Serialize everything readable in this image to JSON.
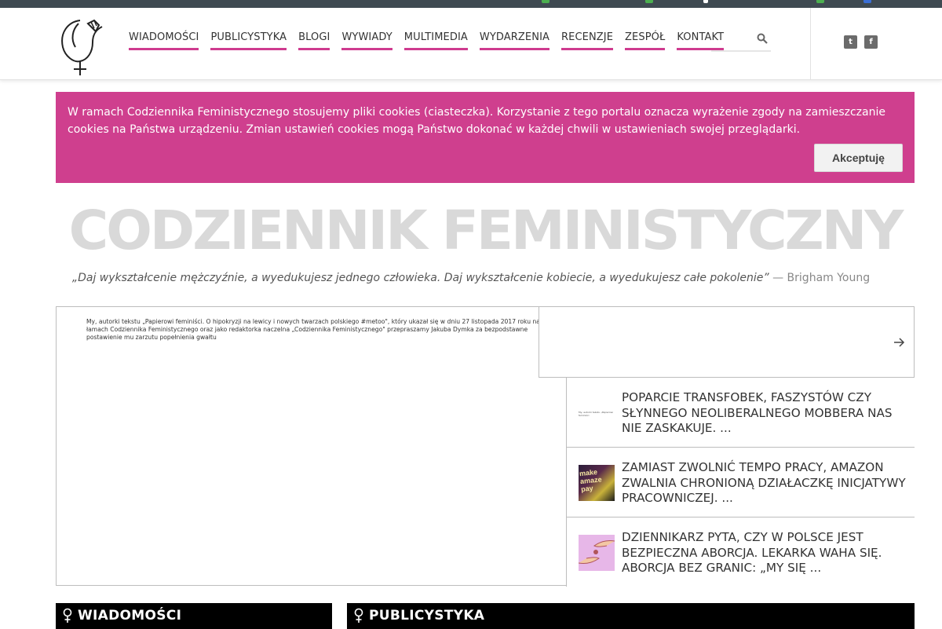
{
  "nav": {
    "items": [
      "WIADOMOŚCI",
      "PUBLICYSTYKA",
      "BLOGI",
      "WYWIADY",
      "MULTIMEDIA",
      "WYDARZENIA",
      "RECENZJE",
      "ZESPÓŁ",
      "KONTAKT"
    ]
  },
  "social": {
    "twitter": "twitter-icon",
    "facebook": "facebook-icon",
    "twitter_glyph": "t",
    "facebook_glyph": "f"
  },
  "cookie": {
    "text": "W ramach Codziennika Feministycznego stosujemy pliki cookies (ciasteczka). Korzystanie z tego portalu oznacza wyrażenie zgody na zamieszczanie cookies na Państwa urządzeniu. Zmian ustawień cookies mogą Państwo dokonać w każdej chwili w ustawieniach swojej przeglądarki.",
    "accept_label": "Akceptuję"
  },
  "site": {
    "title": "CODZIENNIK FEMINISTYCZNY",
    "quote_text": "„Daj wykształcenie mężczyźnie, a wyedukujesz jednego człowieka. Daj wykształcenie kobiecie, a wyedukujesz całe pokolenie”",
    "quote_author": " — Brigham Young"
  },
  "featured": {
    "text": "My, autorki tekstu „Papierowi feminiści. O hipokryzji na lewicy i nowych twarzach polskiego #metoo\", który ukazał się w dniu 27 listopada 2017 roku na łamach Codziennika Feministycznego oraz jako redaktorka naczelna „Codziennika Feministycznego\" przepraszamy Jakuba Dymka za bezpodstawne postawienie mu zarzutu popełnienia gwałtu"
  },
  "side_articles": [
    {
      "title": "POPARCIE TRANSFOBEK, FASZYSTÓW CZY SŁYNNEGO NEOLIBERALNEGO MOBBERA NAS NIE ZASKAKUJE. ...",
      "thumb_text": "My, autorki tekstu „Papierowi feminiści"
    },
    {
      "title": "ZAMIAST ZWOLNIĆ TEMPO PRACY, AMAZON ZWALNIA CHRONIONĄ DZIAŁACZKĘ INICJATYWY PRACOWNICZEJ. ...",
      "thumb_text": "make amaze pay"
    },
    {
      "title": "DZIENNIKARZ PYTA, CZY W POLSCE JEST BEZPIECZNA ABORCJA. LEKARKA WAHA SIĘ. ABORCJA BEZ GRANIC: „MY SIĘ ...",
      "thumb_text": ""
    }
  ],
  "sections": {
    "news": "WIADOMOŚCI",
    "opinion": "PUBLICYSTYKA"
  },
  "colors": {
    "accent": "#cf3f8e",
    "header_bar": "#3f4a52",
    "title_gray": "#d9d9d9",
    "section_bar": "#000000"
  }
}
